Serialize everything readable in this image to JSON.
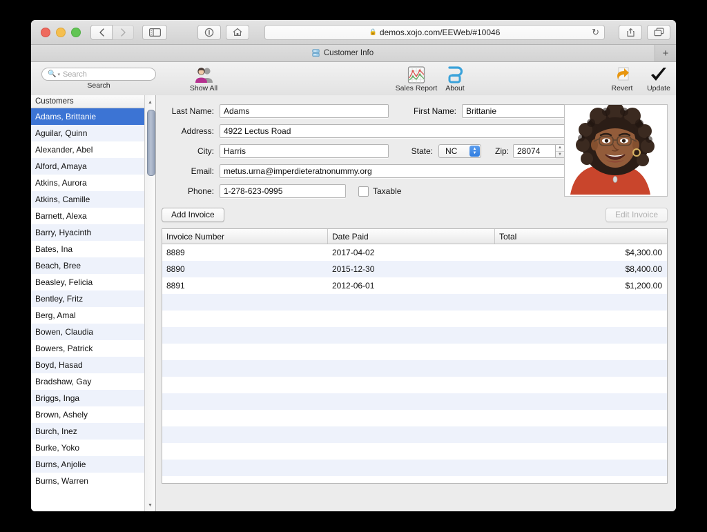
{
  "browser": {
    "url": "demos.xojo.com/EEWeb/#10046",
    "lock_icon": "lock-icon",
    "reload_icon": "reload-icon",
    "back_icon": "back-arrow-icon",
    "forward_icon": "forward-arrow-icon",
    "sidebar_icon": "sidebar-toggle-icon",
    "reader_icon": "reader-icon",
    "home_icon": "home-icon",
    "share_icon": "share-icon",
    "tabs_icon": "show-tabs-icon",
    "new_tab_label": "+"
  },
  "tab": {
    "title": "Customer Info",
    "icon": "database-icon"
  },
  "toolbar": {
    "search": {
      "placeholder": "Search",
      "value": "",
      "label": "Search",
      "icon": "search-icon"
    },
    "show_all": {
      "label": "Show All",
      "icon": "people-icon"
    },
    "sales_report": {
      "label": "Sales Report",
      "icon": "chart-icon"
    },
    "about": {
      "label": "About",
      "icon": "xojo-logo-icon"
    },
    "revert": {
      "label": "Revert",
      "icon": "undo-arrow-icon"
    },
    "update": {
      "label": "Update",
      "icon": "checkmark-icon"
    }
  },
  "sidebar": {
    "header": "Customers",
    "selected_index": 0,
    "items": [
      "Adams, Brittanie",
      "Aguilar, Quinn",
      "Alexander, Abel",
      "Alford, Amaya",
      "Atkins, Aurora",
      "Atkins, Camille",
      "Barnett, Alexa",
      "Barry, Hyacinth",
      "Bates, Ina",
      "Beach, Bree",
      "Beasley, Felicia",
      "Bentley, Fritz",
      "Berg, Amal",
      "Bowen, Claudia",
      "Bowers, Patrick",
      "Boyd, Hasad",
      "Bradshaw, Gay",
      "Briggs, Inga",
      "Brown, Ashely",
      "Burch, Inez",
      "Burke, Yoko",
      "Burns, Anjolie",
      "Burns, Warren"
    ]
  },
  "form": {
    "last_name": {
      "label": "Last Name:",
      "value": "Adams"
    },
    "first_name": {
      "label": "First Name:",
      "value": "Brittanie"
    },
    "address": {
      "label": "Address:",
      "value": "4922 Lectus Road"
    },
    "city": {
      "label": "City:",
      "value": "Harris"
    },
    "state": {
      "label": "State:",
      "value": "NC"
    },
    "zip": {
      "label": "Zip:",
      "value": "28074"
    },
    "email": {
      "label": "Email:",
      "value": "metus.urna@imperdieteratnonummy.org"
    },
    "phone": {
      "label": "Phone:",
      "value": "1-278-623-0995"
    },
    "taxable": {
      "label": "Taxable",
      "checked": false
    },
    "photo_alt": "customer-portrait"
  },
  "invoice_actions": {
    "add": "Add Invoice",
    "edit": "Edit Invoice",
    "edit_disabled": true
  },
  "invoices": {
    "columns": [
      "Invoice Number",
      "Date Paid",
      "Total"
    ],
    "rows": [
      {
        "number": "8889",
        "date": "2017-04-02",
        "total": "$4,300.00"
      },
      {
        "number": "8890",
        "date": "2015-12-30",
        "total": "$8,400.00"
      },
      {
        "number": "8891",
        "date": "2012-06-01",
        "total": "$1,200.00"
      }
    ],
    "empty_row_count": 12
  },
  "colors": {
    "selection_blue": "#3c74d4",
    "stripe": "#eef2fb",
    "chrome_gray": "#ececec",
    "revert_orange": "#e8960f"
  }
}
